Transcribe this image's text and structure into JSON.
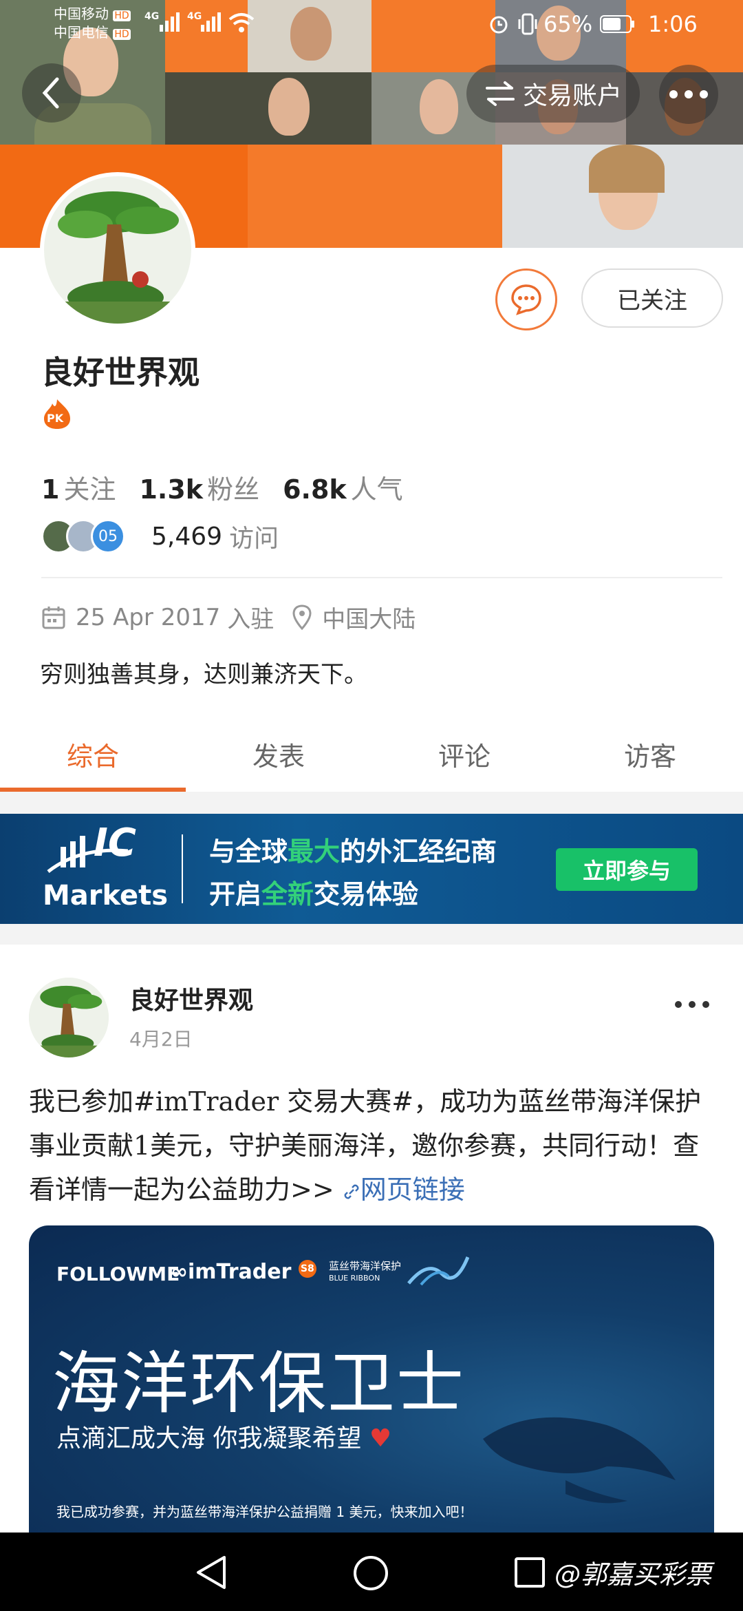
{
  "status_bar": {
    "carrier1": "中国移动",
    "carrier2": "中国电信",
    "hd": "HD",
    "net": "4G",
    "battery": "65%",
    "time": "1:06"
  },
  "header": {
    "trade_account_label": "交易账户"
  },
  "profile": {
    "follow_button": "已关注",
    "name": "良好世界观",
    "badge": "PK",
    "stats": [
      {
        "value": "1",
        "label": "关注"
      },
      {
        "value": "1.3k",
        "label": "粉丝"
      },
      {
        "value": "6.8k",
        "label": "人气"
      }
    ],
    "visitor_count_badge": "05",
    "visits": "5,469",
    "visits_label": "访问",
    "joined_date": "25 Apr 2017",
    "joined_label": "入驻",
    "location": "中国大陆",
    "bio": "穷则独善其身，达则兼济天下。"
  },
  "tabs": [
    {
      "label": "综合",
      "active": true
    },
    {
      "label": "发表",
      "active": false
    },
    {
      "label": "评论",
      "active": false
    },
    {
      "label": "访客",
      "active": false
    }
  ],
  "ad": {
    "brand_ic": "IC",
    "brand_markets": "Markets",
    "line1_a": "与全球",
    "line1_b": "最大",
    "line1_c": "的外汇经纪商",
    "line2_a": "开启",
    "line2_b": "全新",
    "line2_c": "交易体验",
    "cta": "立即参与"
  },
  "post": {
    "author": "良好世界观",
    "date": "4月2日",
    "text": "我已参加#imTrader 交易大赛#，成功为蓝丝带海洋保护事业贡献1美元，守护美丽海洋，邀你参赛，共同行动！查看详情一起为公益助力>>",
    "link_label": "网页链接",
    "image": {
      "logo_followme": "FOLLOWME",
      "logo_imtrader": "imTrader",
      "logo_imtrader_badge": "S8",
      "logo_blue_ribbon_cn": "蓝丝带海洋保护",
      "logo_blue_ribbon_en": "BLUE RIBBON",
      "title": "海洋环保卫士",
      "subtitle": "点滴汇成大海  你我凝聚希望",
      "footer": "我已成功参赛，并为蓝丝带海洋保护公益捐赠 1 美元，快来加入吧！"
    }
  },
  "watermark": "@郭嘉买彩票",
  "colors": {
    "accent": "#ea6a2c",
    "banner_orange": "#f26a14",
    "ad_green": "#18c168",
    "link": "#3b6fb6"
  }
}
